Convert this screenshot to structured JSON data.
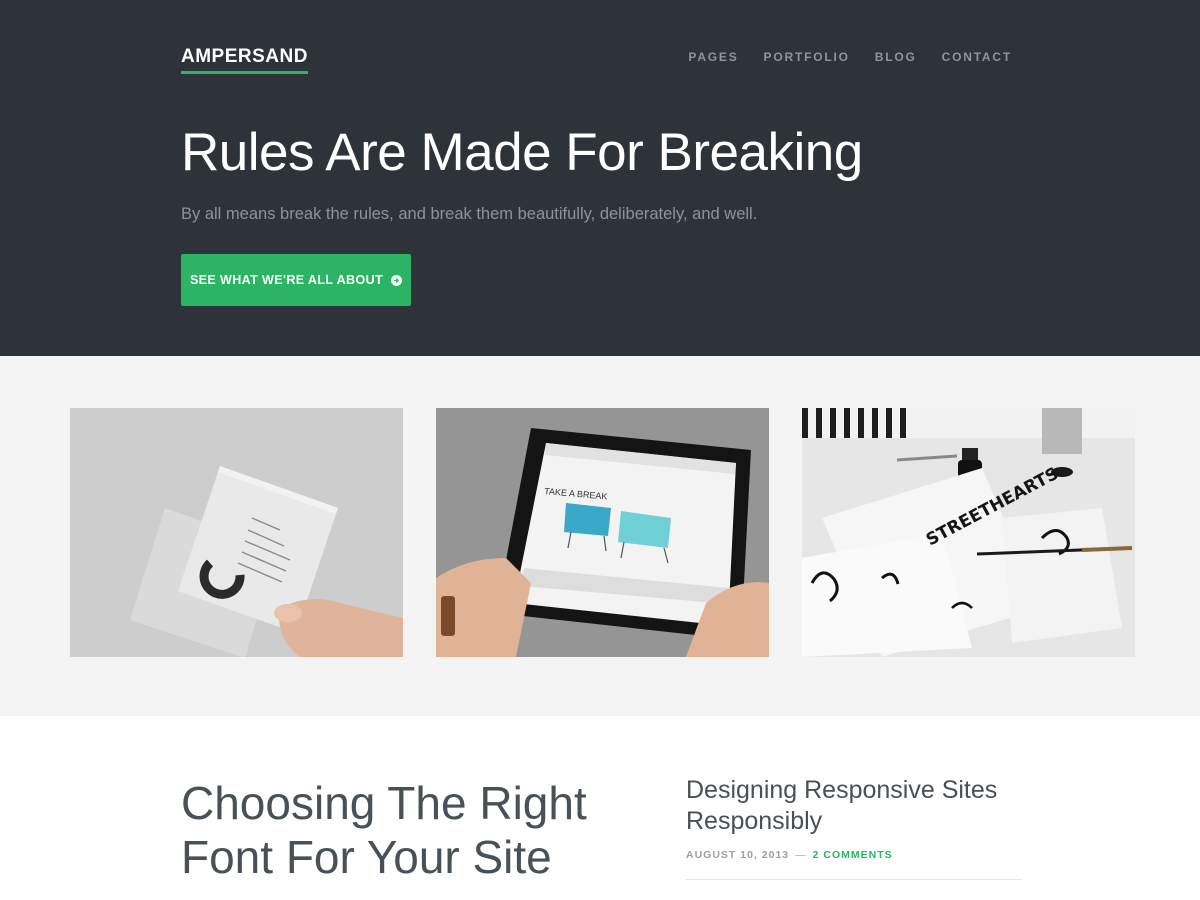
{
  "site": {
    "logo": "AMPERSAND",
    "accent_color": "#2ab464",
    "hero_bg": "#2e333a"
  },
  "nav": {
    "items": [
      {
        "label": "PAGES"
      },
      {
        "label": "PORTFOLIO"
      },
      {
        "label": "BLOG"
      },
      {
        "label": "CONTACT"
      }
    ]
  },
  "hero": {
    "title": "Rules Are Made For Breaking",
    "subtitle": "By all means break the rules, and break them beautifully, deliberately, and well.",
    "cta_label": "SEE WHAT WE'RE ALL ABOUT",
    "cta_icon": "arrow-circle-right-icon"
  },
  "portfolio": {
    "items": [
      {
        "image": "business-cards-photo"
      },
      {
        "image": "tablet-website-photo",
        "screen_text": "TAKE A BREAK"
      },
      {
        "image": "calligraphy-ink-photo",
        "art_text": "STREETHEARTS"
      }
    ]
  },
  "posts": {
    "featured": {
      "title": "Choosing The Right Font For Your Site"
    },
    "secondary": {
      "title": "Designing Responsive Sites Responsibly",
      "date": "AUGUST 10, 2013",
      "separator": "—",
      "comments": "2 COMMENTS"
    }
  }
}
